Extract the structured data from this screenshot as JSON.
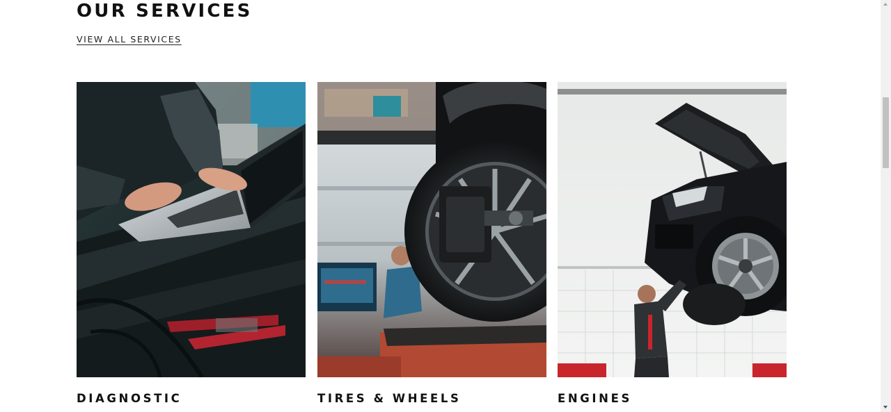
{
  "section": {
    "title": "OUR SERVICES",
    "view_all_label": "VIEW ALL SERVICES"
  },
  "services": [
    {
      "title": "DIAGNOSTIC",
      "image": "mechanic-laptop-photo"
    },
    {
      "title": "TIRES & WHEELS",
      "image": "wheel-alignment-photo"
    },
    {
      "title": "ENGINES",
      "image": "car-on-lift-photo"
    }
  ],
  "colors": {
    "text": "#111111",
    "background": "#ffffff",
    "scrollbar_track": "#f1f1f1",
    "scrollbar_thumb": "#c1c1c1"
  }
}
